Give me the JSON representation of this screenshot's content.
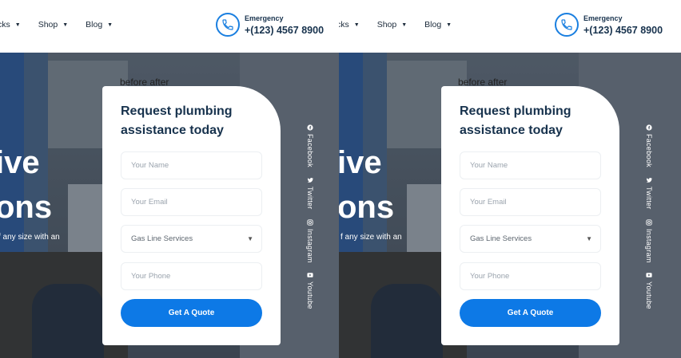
{
  "nav": {
    "items": [
      {
        "label": "cks"
      },
      {
        "label": "Shop"
      },
      {
        "label": "Blog"
      }
    ]
  },
  "emergency": {
    "label": "Emergency",
    "number": "+(123) 4567 8900"
  },
  "hero": {
    "line1": "ive",
    "line2": "ons",
    "tagline": "f any size with an"
  },
  "before_after": "before after",
  "form": {
    "title": "Request plumbing assistance today",
    "name_placeholder": "Your Name",
    "email_placeholder": "Your Email",
    "service_selected": "Gas Line Services",
    "phone_placeholder": "Your Phone",
    "submit_label": "Get A Quote"
  },
  "social": [
    {
      "label": "Facebook",
      "icon": "facebook-icon"
    },
    {
      "label": "Twitter",
      "icon": "twitter-icon"
    },
    {
      "label": "Instagram",
      "icon": "instagram-icon"
    },
    {
      "label": "Youtube",
      "icon": "youtube-icon"
    }
  ],
  "colors": {
    "accent": "#0d79e6",
    "heading": "#17324d"
  }
}
